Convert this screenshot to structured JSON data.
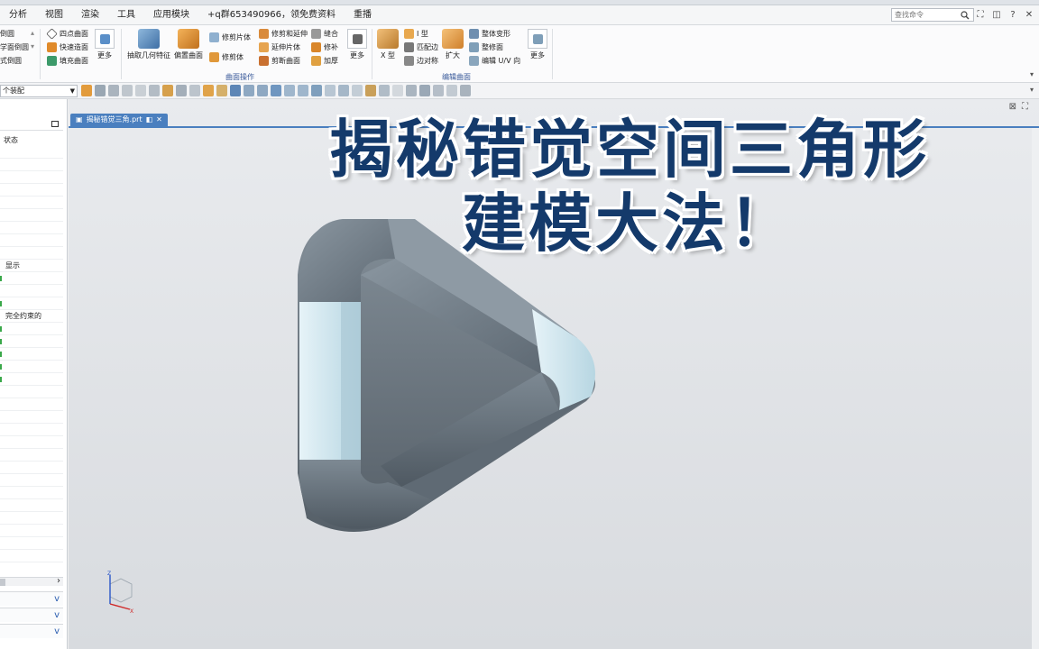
{
  "menu": {
    "items": [
      "分析",
      "视图",
      "渲染",
      "工具",
      "应用模块",
      "+q群653490966，领免费资料",
      "重播"
    ],
    "search_placeholder": "查找命令"
  },
  "ribbon": {
    "left_group": [
      "倒圆",
      "学面倒圆",
      "式倒圆"
    ],
    "surface_small_1": [
      "四点曲面",
      "快速造面",
      "填充曲面"
    ],
    "more_label": "更多",
    "big_buttons": [
      "抽取几何特征",
      "偏置曲面"
    ],
    "trim_col": [
      "修剪片体",
      "修剪体"
    ],
    "trim_col2": [
      "修剪和延伸",
      "延伸片体",
      "剪断曲面"
    ],
    "sew_col": [
      "缝合",
      "修补",
      "加厚"
    ],
    "group_surface_ops": "曲面操作",
    "xtype_label": "X 型",
    "edit_col1": [
      "I 型",
      "匹配边",
      "边对称"
    ],
    "expand_label": "扩大",
    "edit_col2": [
      "整体变形",
      "整修面",
      "编辑 U/V 向"
    ],
    "group_edit_surface": "编辑曲面"
  },
  "selection": {
    "filter_value": "个装配"
  },
  "navigator": {
    "status_col": "状态",
    "row_display": "显示",
    "row_constrained": "完全约束的"
  },
  "document": {
    "tab_name": "揭秘错觉三角.prt"
  },
  "overlay": {
    "line1": "揭秘错觉空间三角形",
    "line2": "建模大法！"
  },
  "colors": {
    "accent_blue": "#4a7fbf",
    "title_color": "#143a6b",
    "model_dark": "#6f7b85",
    "model_light": "#cde6ef"
  }
}
